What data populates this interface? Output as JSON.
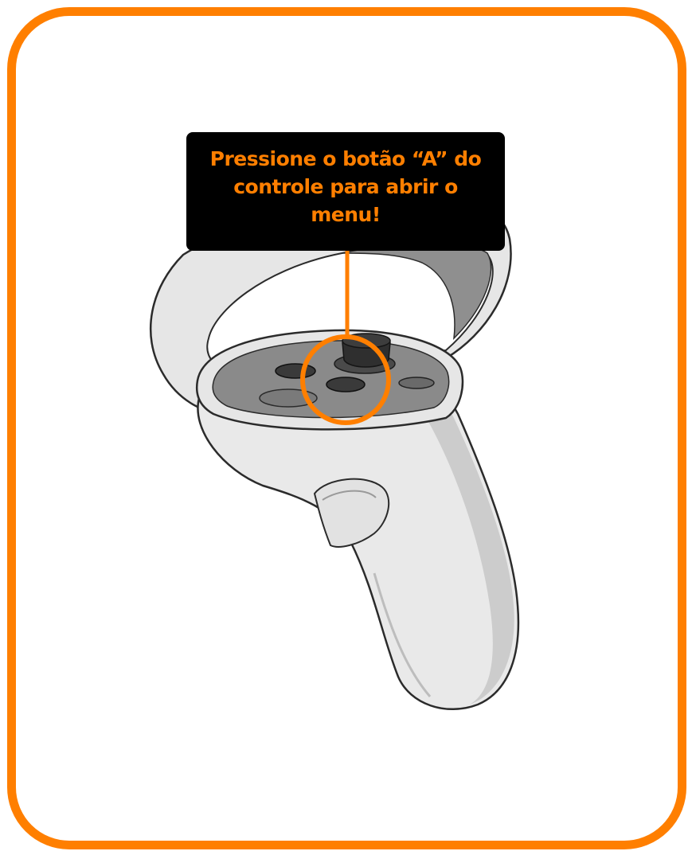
{
  "callout": {
    "text": "Pressione o botão “A” do controle para abrir o menu!"
  },
  "illustration": {
    "subject": "vr-controller",
    "highlighted_control": "a-button"
  },
  "colors": {
    "accent": "#ff7f00",
    "callout_bg": "#000000",
    "background": "#ffffff",
    "controller_body": "#e9e9e9",
    "controller_shadow": "#c9c9c9",
    "face_panel": "#8a8a8a",
    "button": "#3a3a3a"
  }
}
